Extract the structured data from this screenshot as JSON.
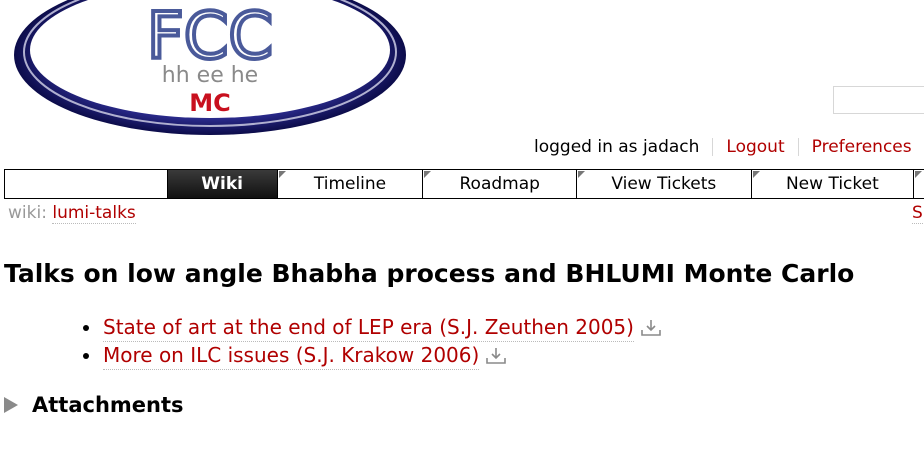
{
  "logo": {
    "line1": "FCC",
    "line2": "hh ee he",
    "line3": "MC"
  },
  "search": {
    "value": ""
  },
  "metanav": {
    "logged_in": "logged in as jadach",
    "logout": "Logout",
    "preferences": "Preferences"
  },
  "mainnav": {
    "items": [
      "Wiki",
      "Timeline",
      "Roadmap",
      "View Tickets",
      "New Ticket"
    ],
    "active": "Wiki"
  },
  "breadcrumb": {
    "prefix": "wiki:",
    "page": "lumi-talks",
    "right_fragment": "S"
  },
  "content": {
    "title": "Talks on low angle Bhabha process and BHLUMI Monte Carlo",
    "talks": [
      "State of art at the end of LEP era (S.J. Zeuthen 2005)",
      "More on ILC issues (S.J. Krakow 2006)"
    ],
    "attachments_heading": "Attachments"
  },
  "colors": {
    "link": "#b00000",
    "logo_blue": "#4a5a9a",
    "logo_ring": "#1a1a6e",
    "logo_red": "#c8101e"
  },
  "icons": {
    "download": "download-icon",
    "expander": "triangle-right-icon"
  }
}
